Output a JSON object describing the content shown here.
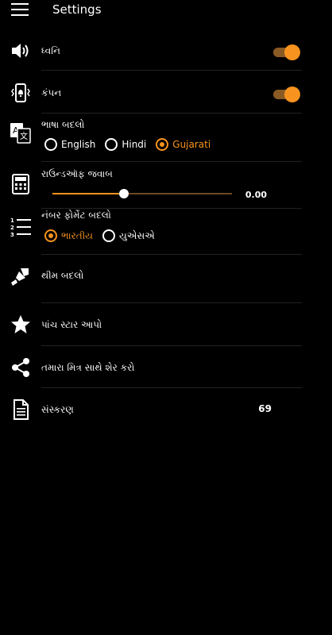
{
  "header": {
    "title": "Settings"
  },
  "sound": {
    "label": "ધ્વનિ",
    "on": true
  },
  "vibration": {
    "label": "કંપન",
    "on": true
  },
  "language": {
    "label": "ભાષા બદલો",
    "options": [
      "English",
      "Hindi",
      "Gujarati"
    ],
    "selected": "Gujarati"
  },
  "roundoff": {
    "label": "રાઉન્ડઑફ જવાબ",
    "value": "0.00",
    "level_fraction": 0.4
  },
  "number_format": {
    "label": "નંબર ફોર્મેટ બદલો",
    "options": [
      "ભારતીય",
      "યુએસએ"
    ],
    "selected": "ભારતીય"
  },
  "theme": {
    "label": "થીમ બદલો"
  },
  "rate": {
    "label": "પાંચ સ્ટાર આપો"
  },
  "share": {
    "label": "તમારા મિત્ર સાથે શેર કરો"
  },
  "version": {
    "label": "સંસ્કરણ",
    "value": "69"
  },
  "colors": {
    "accent": "#f7931e",
    "background": "#000000"
  }
}
